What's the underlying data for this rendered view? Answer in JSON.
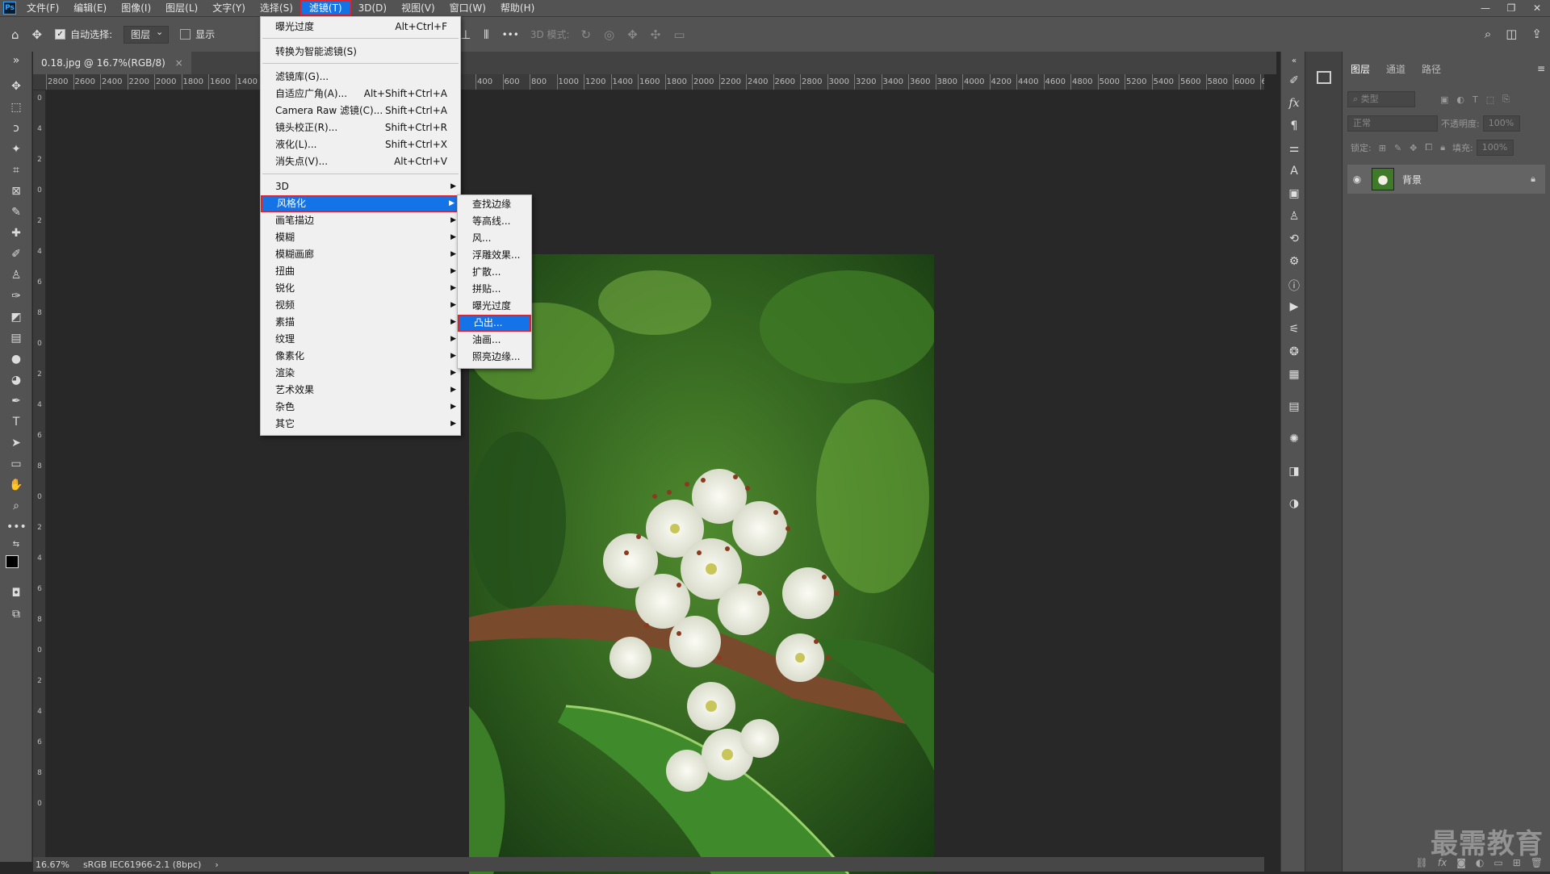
{
  "app": {
    "logo": "Ps",
    "menus": [
      "文件(F)",
      "编辑(E)",
      "图像(I)",
      "图层(L)",
      "文字(Y)",
      "选择(S)",
      "滤镜(T)",
      "3D(D)",
      "视图(V)",
      "窗口(W)",
      "帮助(H)"
    ],
    "active_menu_index": 6,
    "window_controls": [
      "—",
      "❐",
      "✕"
    ]
  },
  "options_bar": {
    "auto_select_label": "自动选择:",
    "auto_select_checked": "✓",
    "target_select": "图层",
    "show_transform_label": "显示",
    "mode_3d_label": "3D 模式:",
    "more": "•••"
  },
  "document": {
    "tab_title": "0.18.jpg @ 16.7%(RGB/8)",
    "tab_close": "×",
    "ruler_h_ticks": [
      "2800",
      "2600",
      "2400",
      "2200",
      "2000",
      "1800",
      "1600",
      "1400",
      "400",
      "600",
      "800",
      "1000",
      "1200",
      "1400",
      "1600",
      "1800",
      "2000",
      "2200",
      "2400",
      "2600",
      "2800",
      "3000",
      "3200",
      "3400",
      "3600",
      "3800",
      "4000",
      "4200",
      "4400",
      "4600",
      "4800",
      "5000",
      "5200",
      "5400",
      "5600",
      "5800",
      "6000",
      "6"
    ],
    "ruler_v_ticks": [
      "0",
      "4",
      "2",
      "0",
      "2",
      "4",
      "6",
      "8",
      "0",
      "2",
      "4",
      "6",
      "8",
      "0",
      "2",
      "4",
      "6",
      "8",
      "0",
      "2",
      "4",
      "6",
      "8",
      "0"
    ]
  },
  "status_bar": {
    "zoom": "16.67%",
    "profile": "sRGB IEC61966-2.1 (8bpc)",
    "arrow": "›"
  },
  "filter_menu": {
    "items": [
      {
        "label": "曝光过度",
        "shortcut": "Alt+Ctrl+F"
      },
      {
        "label": "转换为智能滤镜(S)",
        "shortcut": ""
      },
      {
        "label": "滤镜库(G)...",
        "shortcut": ""
      },
      {
        "label": "自适应广角(A)...",
        "shortcut": "Alt+Shift+Ctrl+A"
      },
      {
        "label": "Camera Raw 滤镜(C)...",
        "shortcut": "Shift+Ctrl+A"
      },
      {
        "label": "镜头校正(R)...",
        "shortcut": "Shift+Ctrl+R"
      },
      {
        "label": "液化(L)...",
        "shortcut": "Shift+Ctrl+X"
      },
      {
        "label": "消失点(V)...",
        "shortcut": "Alt+Ctrl+V"
      }
    ],
    "submenus": [
      "3D",
      "风格化",
      "画笔描边",
      "模糊",
      "模糊画廊",
      "扭曲",
      "锐化",
      "视频",
      "素描",
      "纹理",
      "像素化",
      "渲染",
      "艺术效果",
      "杂色",
      "其它"
    ],
    "highlighted_submenu": "风格化"
  },
  "stylize_menu": {
    "items": [
      "查找边缘",
      "等高线...",
      "风...",
      "浮雕效果...",
      "扩散...",
      "拼贴...",
      "曝光过度",
      "凸出...",
      "油画...",
      "照亮边缘..."
    ],
    "highlighted": "凸出..."
  },
  "layers_panel": {
    "tabs": [
      "图层",
      "通道",
      "路径"
    ],
    "search_placeholder": "类型",
    "blend_mode": "正常",
    "opacity_label": "不透明度:",
    "opacity_value": "100%",
    "lock_label": "锁定:",
    "fill_label": "填充:",
    "fill_value": "100%",
    "layers": [
      {
        "name": "背景",
        "visible": true,
        "locked": true
      }
    ]
  },
  "watermark": "最需教育",
  "colors": {
    "accent": "#1473e6",
    "highlight_border": "#e0232d",
    "panel_bg": "#535353",
    "canvas_bg": "#282828"
  }
}
